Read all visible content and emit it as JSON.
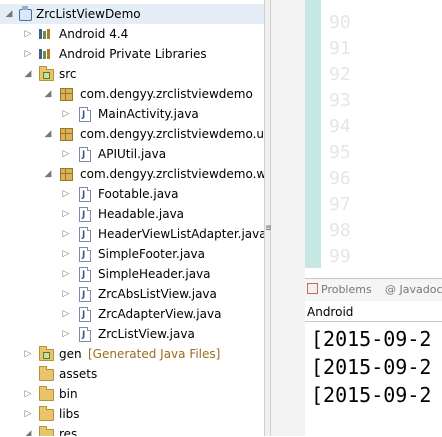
{
  "tree": {
    "project": {
      "label": "ZrcListViewDemo",
      "twisty": "◢"
    },
    "android": {
      "label": "Android 4.4",
      "twisty": "▷"
    },
    "private_libs": {
      "label": "Android Private Libraries",
      "twisty": "▷"
    },
    "src": {
      "label": "src",
      "twisty": "◢"
    },
    "pkg1": {
      "label": "com.dengyy.zrclistviewdemo",
      "twisty": "◢"
    },
    "pkg1_files": [
      "MainActivity.java"
    ],
    "pkg2": {
      "label": "com.dengyy.zrclistviewdemo.util",
      "twisty": "◢"
    },
    "pkg2_files": [
      "APIUtil.java"
    ],
    "pkg3": {
      "label": "com.dengyy.zrclistviewdemo.wic",
      "twisty": "◢"
    },
    "pkg3_files": [
      "Footable.java",
      "Headable.java",
      "HeaderViewListAdapter.java",
      "SimpleFooter.java",
      "SimpleHeader.java",
      "ZrcAbsListView.java",
      "ZrcAdapterView.java",
      "ZrcListView.java"
    ],
    "gen": {
      "label": "gen",
      "decoration": "[Generated Java Files]",
      "twisty": "▷"
    },
    "assets": {
      "label": "assets"
    },
    "bin": {
      "label": "bin",
      "twisty": "▷"
    },
    "libs": {
      "label": "libs",
      "twisty": "▷"
    },
    "res": {
      "label": "res",
      "twisty": "◢"
    },
    "twisty_collapsed": "▷"
  },
  "splitter": {
    "grip": "≡"
  },
  "editor": {
    "line_numbers": [
      "90",
      "91",
      "92",
      "93",
      "94",
      "95",
      "96",
      "97",
      "98",
      "99"
    ]
  },
  "panel": {
    "tabs": {
      "problems": "Problems",
      "javadoc": "@ Javadoc"
    },
    "console_title": "Android",
    "log_lines": [
      "[2015-09-2",
      "[2015-09-2",
      "[2015-09-2"
    ]
  },
  "colors": {
    "selection": "#e5edf7",
    "editor_stripe": "#c7e8e2",
    "decoration": "#9a6c1f"
  }
}
